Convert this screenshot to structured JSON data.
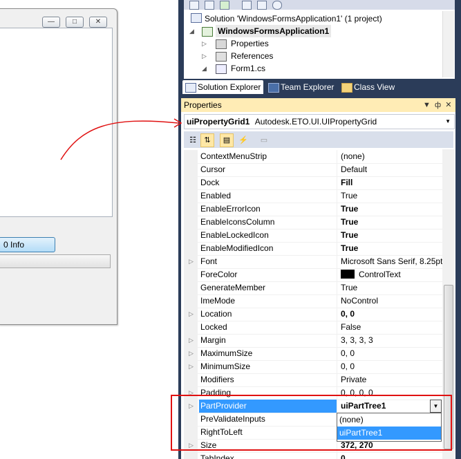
{
  "form_designer": {
    "info_button_label": "0 Info",
    "caption_buttons": [
      "minimize-icon",
      "maximize-icon",
      "close-icon"
    ]
  },
  "solution_explorer": {
    "toolbar_icons": [
      "properties-icon",
      "show-all-files-icon",
      "refresh-icon",
      "view-code-icon",
      "view-designer-icon"
    ],
    "tree": [
      {
        "label": "Solution 'WindowsFormsApplication1' (1 project)",
        "icon": "solution-icon"
      },
      {
        "label": "WindowsFormsApplication1",
        "icon": "csharp-project-icon",
        "bold": true
      },
      {
        "label": "Properties",
        "icon": "folder-properties-icon"
      },
      {
        "label": "References",
        "icon": "references-icon"
      },
      {
        "label": "Form1.cs",
        "icon": "form-icon"
      }
    ]
  },
  "tabs": [
    {
      "label": "Solution Explorer",
      "icon": "solution-explorer-icon",
      "active": true
    },
    {
      "label": "Team Explorer",
      "icon": "team-explorer-icon",
      "active": false
    },
    {
      "label": "Class View",
      "icon": "class-view-icon",
      "active": false
    }
  ],
  "properties": {
    "title": "Properties",
    "object_name": "uiPropertyGrid1",
    "object_type": "Autodesk.ETO.UI.UIPropertyGrid",
    "rows": [
      {
        "name": "ContextMenuStrip",
        "value": "(none)",
        "bold": false,
        "expandable": false
      },
      {
        "name": "Cursor",
        "value": "Default",
        "bold": false,
        "expandable": false
      },
      {
        "name": "Dock",
        "value": "Fill",
        "bold": true,
        "expandable": false
      },
      {
        "name": "Enabled",
        "value": "True",
        "bold": false,
        "expandable": false
      },
      {
        "name": "EnableErrorIcon",
        "value": "True",
        "bold": true,
        "expandable": false
      },
      {
        "name": "EnableIconsColumn",
        "value": "True",
        "bold": true,
        "expandable": false
      },
      {
        "name": "EnableLockedIcon",
        "value": "True",
        "bold": true,
        "expandable": false
      },
      {
        "name": "EnableModifiedIcon",
        "value": "True",
        "bold": true,
        "expandable": false
      },
      {
        "name": "Font",
        "value": "Microsoft Sans Serif, 8.25pt",
        "bold": false,
        "expandable": true
      },
      {
        "name": "ForeColor",
        "value": "ControlText",
        "bold": false,
        "expandable": false,
        "swatch": "#000000"
      },
      {
        "name": "GenerateMember",
        "value": "True",
        "bold": false,
        "expandable": false
      },
      {
        "name": "ImeMode",
        "value": "NoControl",
        "bold": false,
        "expandable": false
      },
      {
        "name": "Location",
        "value": "0, 0",
        "bold": true,
        "expandable": true
      },
      {
        "name": "Locked",
        "value": "False",
        "bold": false,
        "expandable": false
      },
      {
        "name": "Margin",
        "value": "3, 3, 3, 3",
        "bold": false,
        "expandable": true
      },
      {
        "name": "MaximumSize",
        "value": "0, 0",
        "bold": false,
        "expandable": true
      },
      {
        "name": "MinimumSize",
        "value": "0, 0",
        "bold": false,
        "expandable": true
      },
      {
        "name": "Modifiers",
        "value": "Private",
        "bold": false,
        "expandable": false
      },
      {
        "name": "Padding",
        "value": "0, 0, 0, 0",
        "bold": false,
        "expandable": true
      },
      {
        "name": "PartProvider",
        "value": "uiPartTree1",
        "bold": true,
        "expandable": true,
        "selected": true
      },
      {
        "name": "PreValidateInputs",
        "value": "",
        "bold": false,
        "expandable": false
      },
      {
        "name": "RightToLeft",
        "value": "",
        "bold": false,
        "expandable": false
      },
      {
        "name": "Size",
        "value": "372, 270",
        "bold": true,
        "expandable": true
      },
      {
        "name": "TabIndex",
        "value": "0",
        "bold": true,
        "expandable": false
      }
    ],
    "dropdown": {
      "options": [
        "(none)",
        "uiPartTree1"
      ],
      "highlighted": "uiPartTree1"
    }
  },
  "colors": {
    "frame": "#2b3c59",
    "properties_title_bg": "#ffecb5",
    "selection": "#3399ff",
    "annotation": "#e01010"
  }
}
